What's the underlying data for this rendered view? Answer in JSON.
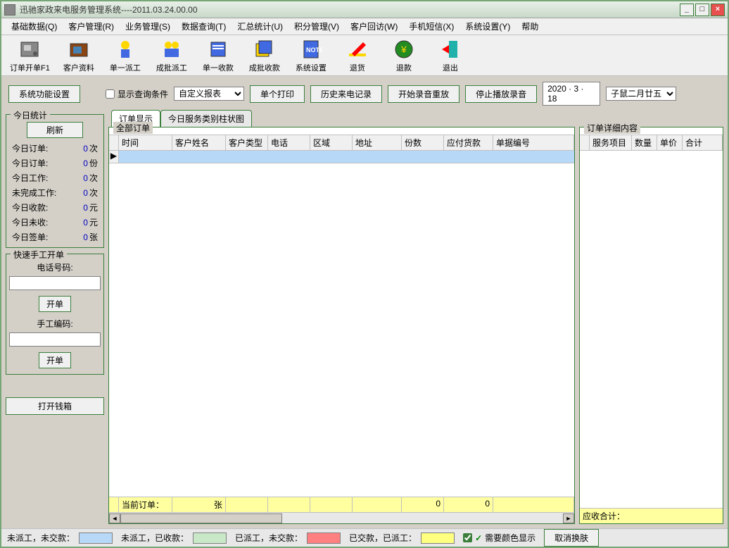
{
  "window": {
    "title": "迅驰家政来电服务管理系统----2011.03.24.00.00"
  },
  "menu": {
    "m1": "基础数据(Q)",
    "m2": "客户管理(R)",
    "m3": "业务管理(S)",
    "m4": "数据查询(T)",
    "m5": "汇总统计(U)",
    "m6": "积分管理(V)",
    "m7": "客户回访(W)",
    "m8": "手机短信(X)",
    "m9": "系统设置(Y)",
    "m10": "帮助"
  },
  "toolbar": {
    "t1": "订单开单F1",
    "t2": "客户资料",
    "t3": "单一派工",
    "t4": "成批派工",
    "t5": "单一收款",
    "t6": "成批收款",
    "t7": "系统设置",
    "t8": "退货",
    "t9": "退款",
    "t10": "退出"
  },
  "controls": {
    "settings_btn": "系统功能设置",
    "show_query": "显示查询条件",
    "report_select": "自定义报表",
    "single_print": "单个打印",
    "history_call": "历史来电记录",
    "start_replay": "开始录音重放",
    "stop_play": "停止播放录音",
    "date": "2020 · 3  · 18",
    "lunar": "子鼠二月廿五"
  },
  "sidebar": {
    "today_stats": "今日统计",
    "refresh": "刷新",
    "s1": {
      "label": "今日订单:",
      "val": "0",
      "unit": "次"
    },
    "s2": {
      "label": "今日订单:",
      "val": "0",
      "unit": "份"
    },
    "s3": {
      "label": "今日工作:",
      "val": "0",
      "unit": "次"
    },
    "s4": {
      "label": "未完成工作:",
      "val": "0",
      "unit": "次"
    },
    "s5": {
      "label": "今日收款:",
      "val": "0",
      "unit": "元"
    },
    "s6": {
      "label": "今日未收:",
      "val": "0",
      "unit": "元"
    },
    "s7": {
      "label": "今日签单:",
      "val": "0",
      "unit": "张"
    },
    "quick_open": "快速手工开单",
    "phone_label": "电话号码:",
    "open_btn": "开单",
    "manual_code": "手工编码:",
    "open_btn2": "开单",
    "cashbox": "打开钱箱"
  },
  "tabs": {
    "t1": "订单显示",
    "t2": "今日服务类别柱状图"
  },
  "left_panel": {
    "title": "全部订单",
    "cols": {
      "c1": "时间",
      "c2": "客户姓名",
      "c3": "客户类型",
      "c4": "电话",
      "c5": "区域",
      "c6": "地址",
      "c7": "份数",
      "c8": "应付货款",
      "c9": "单据编号"
    },
    "footer": {
      "label": "当前订单：",
      "zhang": "张",
      "v1": "0",
      "v2": "0"
    }
  },
  "right_panel": {
    "title": "订单详细内容",
    "cols": {
      "c1": "服务项目",
      "c2": "数量",
      "c3": "单价",
      "c4": "合计"
    },
    "footer": "应收合计："
  },
  "status": {
    "s1": "未派工，未交款：",
    "s2": "未派工，已收款：",
    "s3": "已派工，未交款：",
    "s4": "已交款，已派工：",
    "chk": "需要颜色显示",
    "cancel_skin": "取消换肤"
  }
}
